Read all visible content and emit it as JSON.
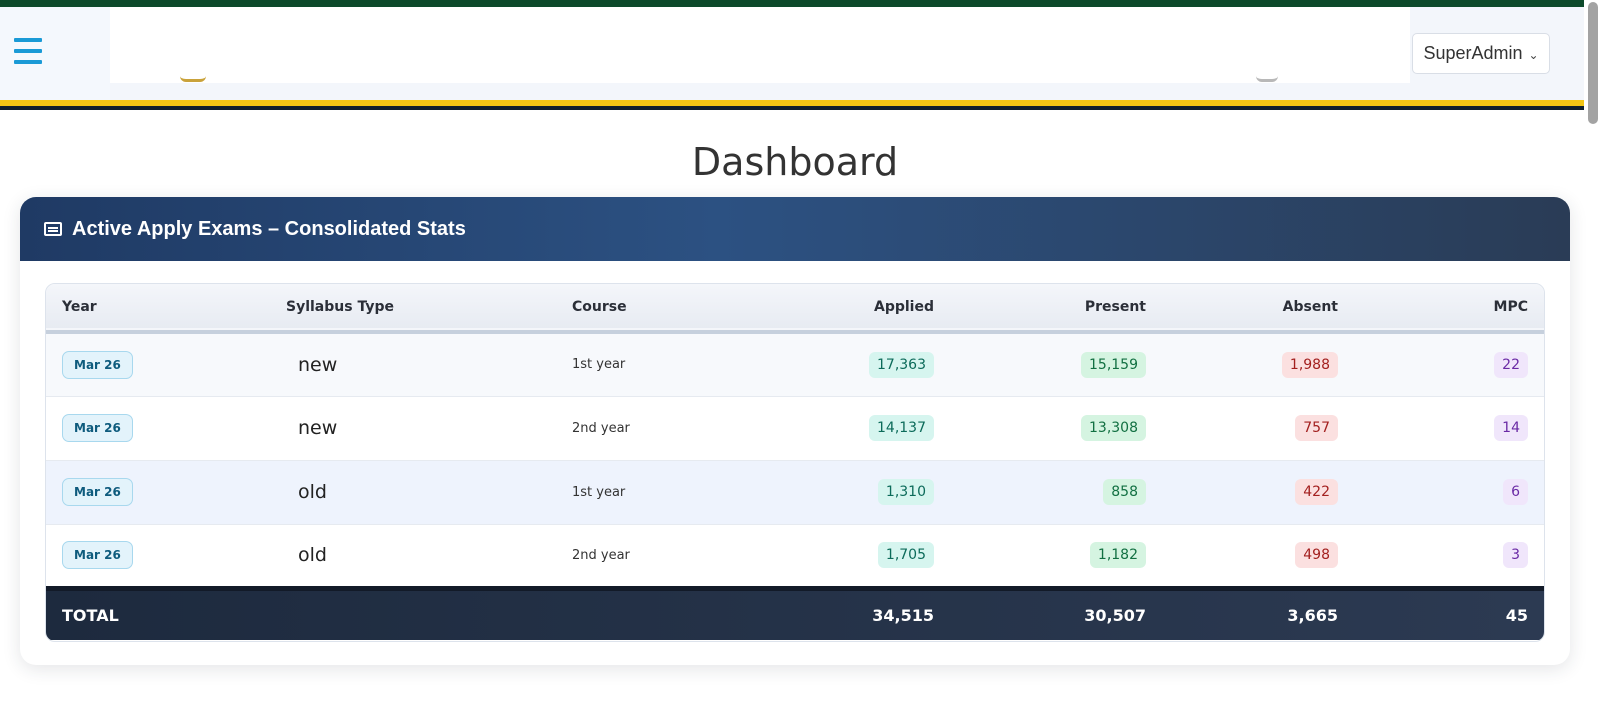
{
  "header": {
    "user_label": "SuperAdmin"
  },
  "page": {
    "title": "Dashboard"
  },
  "card": {
    "title": "Active Apply Exams – Consolidated Stats"
  },
  "table": {
    "columns": [
      "Year",
      "Syllabus Type",
      "Course",
      "Applied",
      "Present",
      "Absent",
      "MPC"
    ],
    "rows": [
      {
        "year": "Mar 26",
        "syllabus": "new",
        "course": "1st year",
        "applied": "17,363",
        "present": "15,159",
        "absent": "1,988",
        "mpc": "22"
      },
      {
        "year": "Mar 26",
        "syllabus": "new",
        "course": "2nd year",
        "applied": "14,137",
        "present": "13,308",
        "absent": "757",
        "mpc": "14"
      },
      {
        "year": "Mar 26",
        "syllabus": "old",
        "course": "1st year",
        "applied": "1,310",
        "present": "858",
        "absent": "422",
        "mpc": "6"
      },
      {
        "year": "Mar 26",
        "syllabus": "old",
        "course": "2nd year",
        "applied": "1,705",
        "present": "1,182",
        "absent": "498",
        "mpc": "3"
      }
    ],
    "total": {
      "label": "TOTAL",
      "applied": "34,515",
      "present": "30,507",
      "absent": "3,665",
      "mpc": "45"
    }
  },
  "colors": {
    "top_strip": "#0d4a2b",
    "yellow_strip": "#f2c515",
    "menu_icon": "#1a9ad6",
    "card_header": "#2c5182"
  },
  "icons": {
    "menu": "hamburger-icon",
    "card": "list-icon",
    "dropdown": "chevron-down-icon"
  }
}
